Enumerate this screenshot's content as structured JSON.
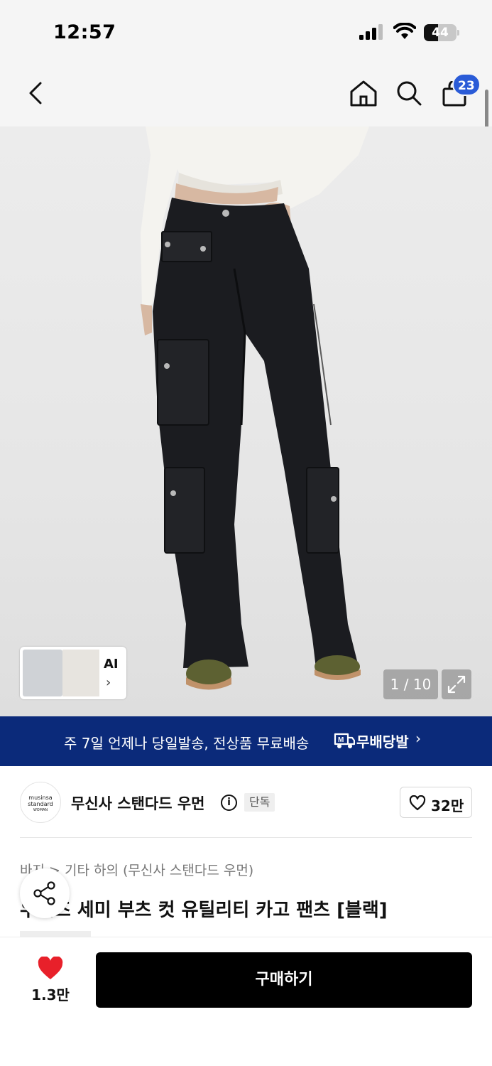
{
  "status_bar": {
    "time": "12:57",
    "battery": "44",
    "battery_level": 0.44
  },
  "nav": {
    "back_icon": "chevron-left-icon",
    "home_icon": "home-icon",
    "search_icon": "search-icon",
    "cart_icon": "shopping-bag-icon",
    "cart_badge": "23"
  },
  "gallery": {
    "ai_label": "AI",
    "ai_chevron": "›",
    "pager": "1 / 10",
    "expand_icon": "expand-icon"
  },
  "promo": {
    "text": "주 7일 언제나 당일발송, 전상품 무료배송",
    "brand_label": "무배당발",
    "chevron": "›"
  },
  "store": {
    "logo_line1": "musinsa",
    "logo_line2": "standard",
    "logo_line3": "WOMAN",
    "name": "무신사 스탠다드 우먼",
    "info_icon": "i",
    "exclusive_badge": "단독",
    "likes": "32만"
  },
  "product": {
    "breadcrumb": [
      "바지",
      "기타 하의 (무신사 스탠다드 우먼)"
    ],
    "breadcrumb_sep": ">",
    "title": "우먼즈 세미 부츠 컷 유틸리티 카고 팬츠 [블랙]"
  },
  "bottom_bar": {
    "heart_count": "1.3만",
    "buy_label": "구매하기"
  },
  "colors": {
    "promo_bg": "#0b2a7a",
    "badge": "#2a5bd7",
    "heart": "#e8202a",
    "buy_bg": "#000000"
  }
}
